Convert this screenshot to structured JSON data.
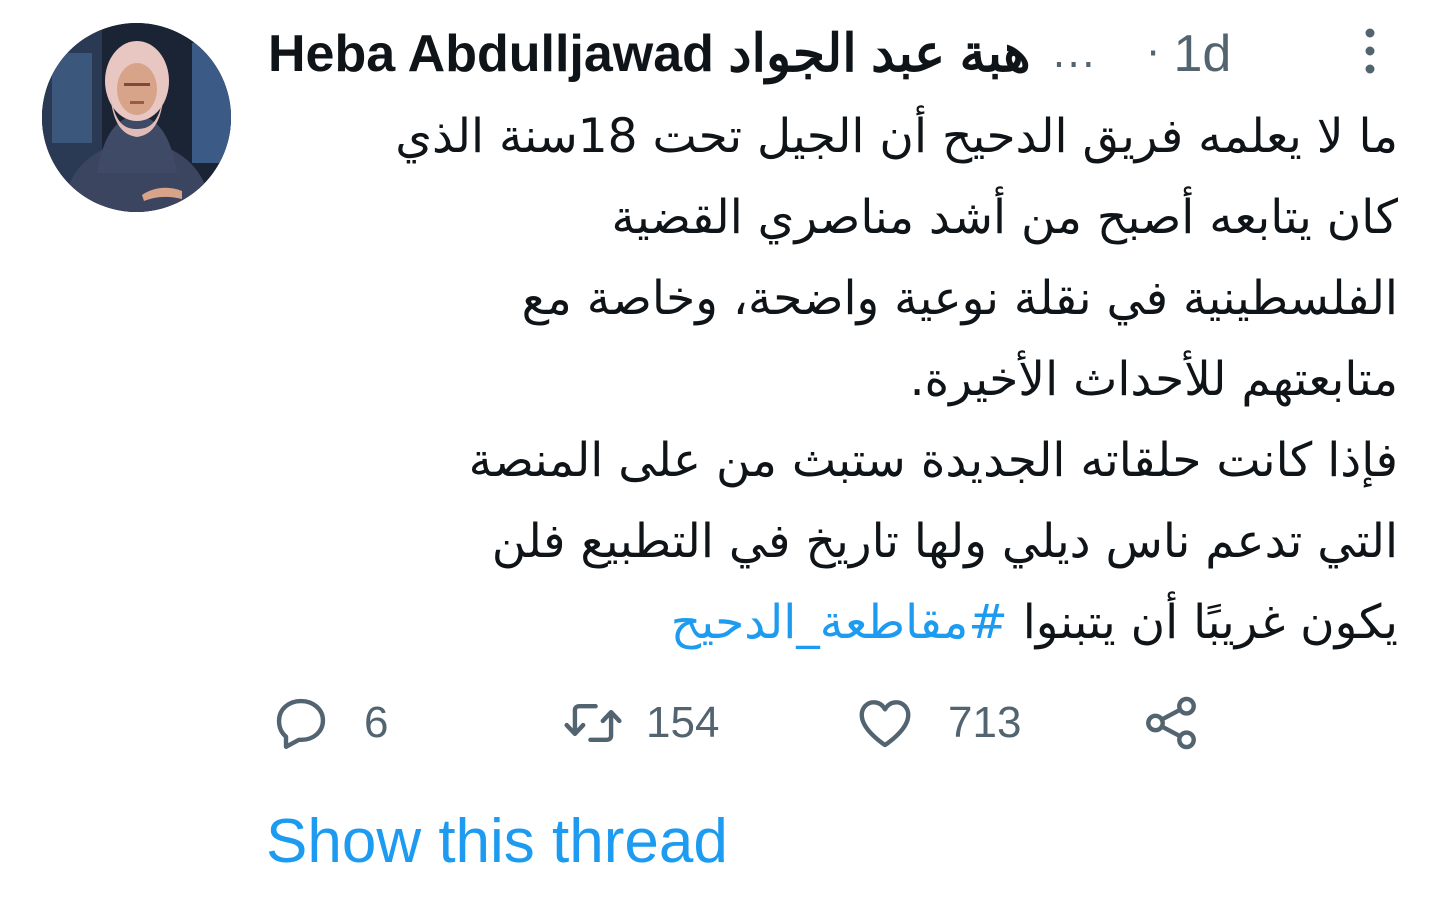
{
  "author": {
    "display_name": "Heba Abdulljawad هبة عبد الجواد",
    "truncation": "...",
    "separator": "·",
    "timestamp": "1d"
  },
  "tweet": {
    "lines": [
      "ما لا يعلمه فريق الدحيح أن الجيل تحت 18سنة الذي",
      "كان يتابعه أصبح من أشد مناصري القضية",
      "الفلسطينية في نقلة نوعية واضحة، وخاصة مع",
      "متابعتهم للأحداث الأخيرة.",
      "فإذا كانت حلقاته الجديدة ستبث من على المنصة",
      "التي تدعم ناس ديلي ولها تاريخ في التطبيع فلن",
      "يكون غريبًا أن يتبنوا"
    ],
    "hashtag": "#مقاطعة_الدحيح"
  },
  "actions": {
    "reply_count": "6",
    "retweet_count": "154",
    "like_count": "713"
  },
  "show_thread": "Show this thread",
  "colors": {
    "accent": "#1d9bf0",
    "muted": "#536471",
    "text": "#0f1419"
  },
  "icons": [
    "more-vertical-icon",
    "reply-icon",
    "retweet-icon",
    "like-icon",
    "share-icon"
  ]
}
